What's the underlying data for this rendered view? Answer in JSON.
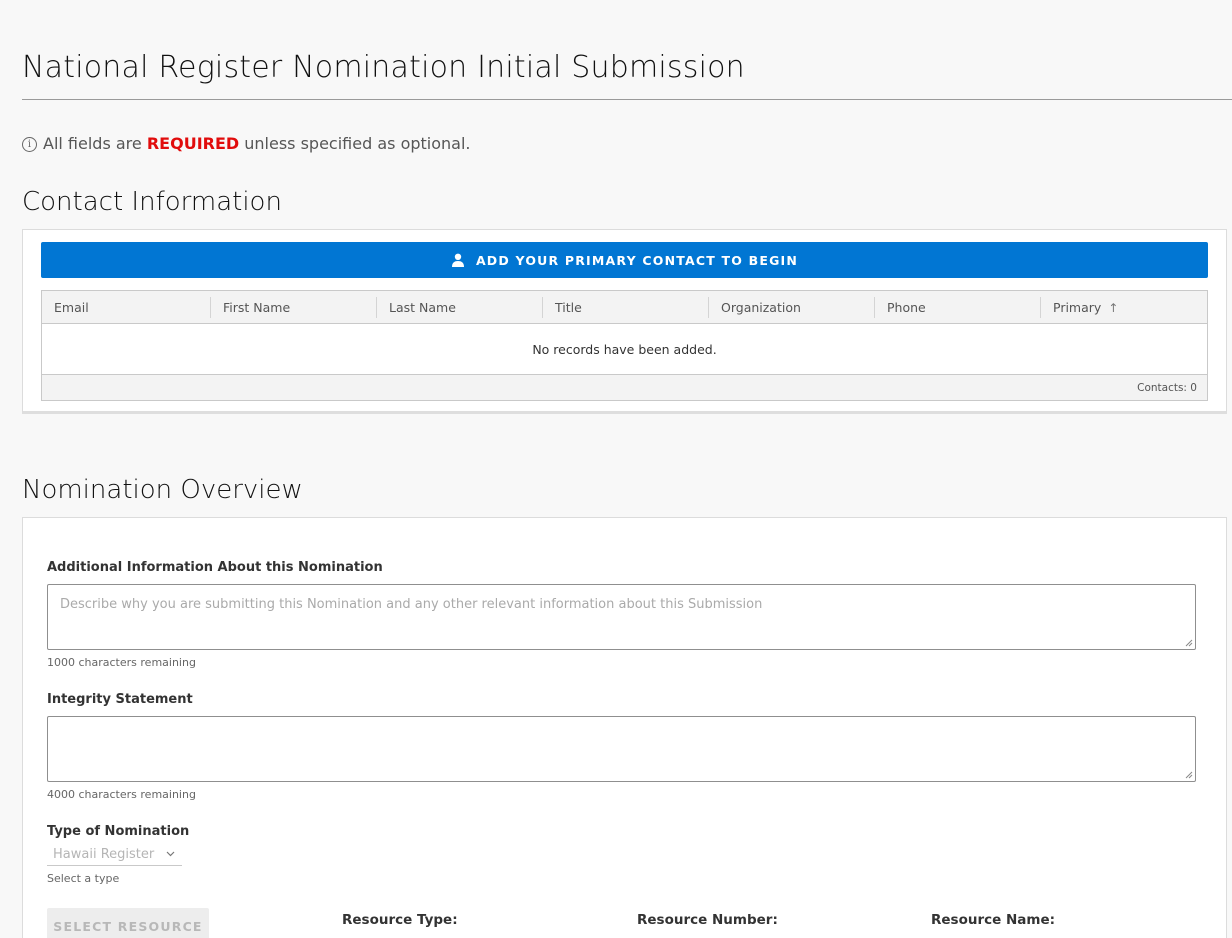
{
  "page": {
    "title": "National Register Nomination Initial Submission",
    "required_note": {
      "prefix": "All fields are",
      "keyword": "REQUIRED",
      "suffix": "unless specified as optional."
    }
  },
  "contact_section": {
    "title": "Contact Information",
    "add_button_label": "ADD YOUR PRIMARY CONTACT TO BEGIN",
    "columns": [
      "Email",
      "First Name",
      "Last Name",
      "Title",
      "Organization",
      "Phone",
      "Primary"
    ],
    "sorted_column_icon": "arrow-up-icon",
    "empty_message": "No records have been added.",
    "footer_count": "Contacts: 0"
  },
  "overview_section": {
    "title": "Nomination Overview",
    "additional_info": {
      "label": "Additional Information About this Nomination",
      "placeholder": "Describe why you are submitting this Nomination and any other relevant information about this Submission",
      "value": "",
      "remaining": "1000 characters remaining"
    },
    "integrity": {
      "label": "Integrity Statement",
      "placeholder": "",
      "value": "",
      "remaining": "4000 characters remaining"
    },
    "nomination_type": {
      "label": "Type of Nomination",
      "selected": "Hawaii Register",
      "helper": "Select a type"
    },
    "select_resource_label": "SELECT RESOURCE",
    "resource_type_label": "Resource Type:",
    "resource_number_label": "Resource Number:",
    "resource_name_label": "Resource Name:"
  },
  "colors": {
    "brand_blue": "#0176d3",
    "required_red": "#e10c0c"
  }
}
